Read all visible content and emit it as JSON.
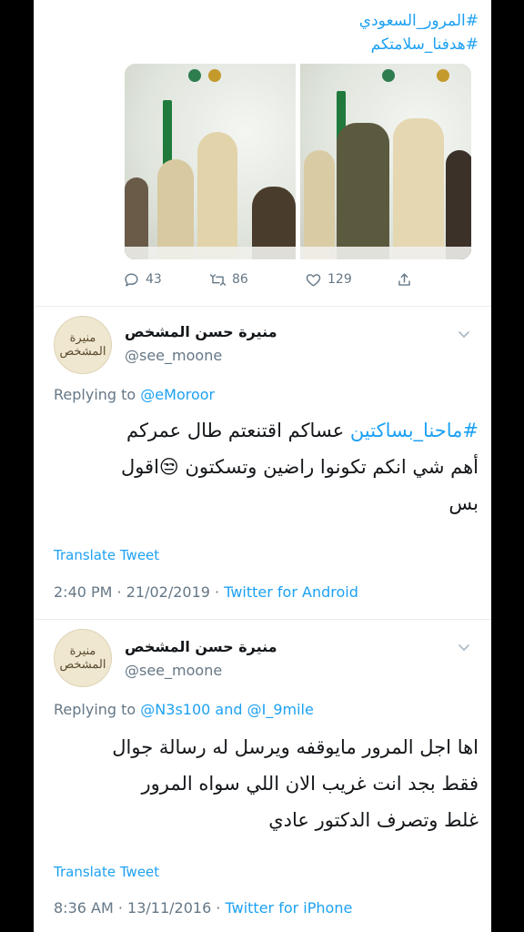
{
  "top_tweet": {
    "hashtags": [
      "#المرور_السعودي",
      "#هدفنا_سلامتكم"
    ],
    "actions": {
      "replies": "43",
      "retweets": "86",
      "likes": "129"
    }
  },
  "replies": [
    {
      "avatar_text": "منيرة المشخص",
      "display_name": "منيرة حسن المشخص",
      "handle": "@see_moone",
      "replying_prefix": "Replying to",
      "replying_mention_1": "@eMoroor",
      "body_tag": "#ماحنا_بساكتين",
      "body_line1_rest": " عساكم اقتنعتم طال عمركم",
      "body_line2": "أهم شي انكم تكونوا راضين وتسكتون 😒اقول",
      "body_line3": "بس",
      "translate_label": "Translate Tweet",
      "meta_time": "2:40 PM · 21/02/2019 · ",
      "meta_source": "Twitter for Android"
    },
    {
      "avatar_text": "منيرة المشخص",
      "display_name": "منيرة حسن المشخص",
      "handle": "@see_moone",
      "replying_prefix": "Replying to",
      "replying_mention_1": "@N3s100",
      "replying_and": "and",
      "replying_mention_2": "@I_9mile",
      "body_line1": "اها اجل المرور مايوقفه ويرسل له رسالة جوال",
      "body_line2": "فقط بجد انت غريب الان اللي سواه المرور",
      "body_line3": "غلط وتصرف الدكتور عادي",
      "translate_label": "Translate Tweet",
      "meta_time": "8:36 AM · 13/11/2016 · ",
      "meta_source": "Twitter for iPhone"
    }
  ]
}
